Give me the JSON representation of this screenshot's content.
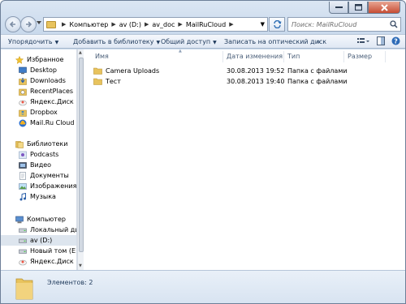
{
  "window": {
    "controls": [
      "minimize",
      "maximize",
      "close"
    ]
  },
  "address": {
    "crumbs": [
      "Компьютер",
      "av (D:)",
      "av_doc",
      "MailRuCloud"
    ],
    "search_placeholder": "Поиск: MailRuCloud"
  },
  "toolbar": {
    "organize": "Упорядочить",
    "add_to_library": "Добавить в библиотеку",
    "share": "Общий доступ",
    "burn": "Записать на оптический диск",
    "more": "»"
  },
  "sidebar": {
    "favorites_header": "Избранное",
    "favorites": [
      "Desktop",
      "Downloads",
      "RecentPlaces",
      "Яндекс.Диск",
      "Dropbox",
      "Mail.Ru Cloud"
    ],
    "libraries_header": "Библиотеки",
    "libraries": [
      "Podcasts",
      "Видео",
      "Документы",
      "Изображения",
      "Музыка"
    ],
    "computer_header": "Компьютер",
    "computer": [
      "Локальный диск",
      "av (D:)",
      "Новый том (E:)",
      "Яндекс.Диск"
    ]
  },
  "columns": {
    "name": "Имя",
    "date": "Дата изменения",
    "type": "Тип",
    "size": "Размер"
  },
  "files": [
    {
      "name": "Camera Uploads",
      "date": "30.08.2013 19:52",
      "type": "Папка с файлами"
    },
    {
      "name": "Тест",
      "date": "30.08.2013 19:40",
      "type": "Папка с файлами"
    }
  ],
  "status": {
    "count": "Элементов: 2"
  },
  "colors": {
    "folder": "#e8c35d",
    "selection": "#dde5ee",
    "accent_text": "#1e395b"
  }
}
